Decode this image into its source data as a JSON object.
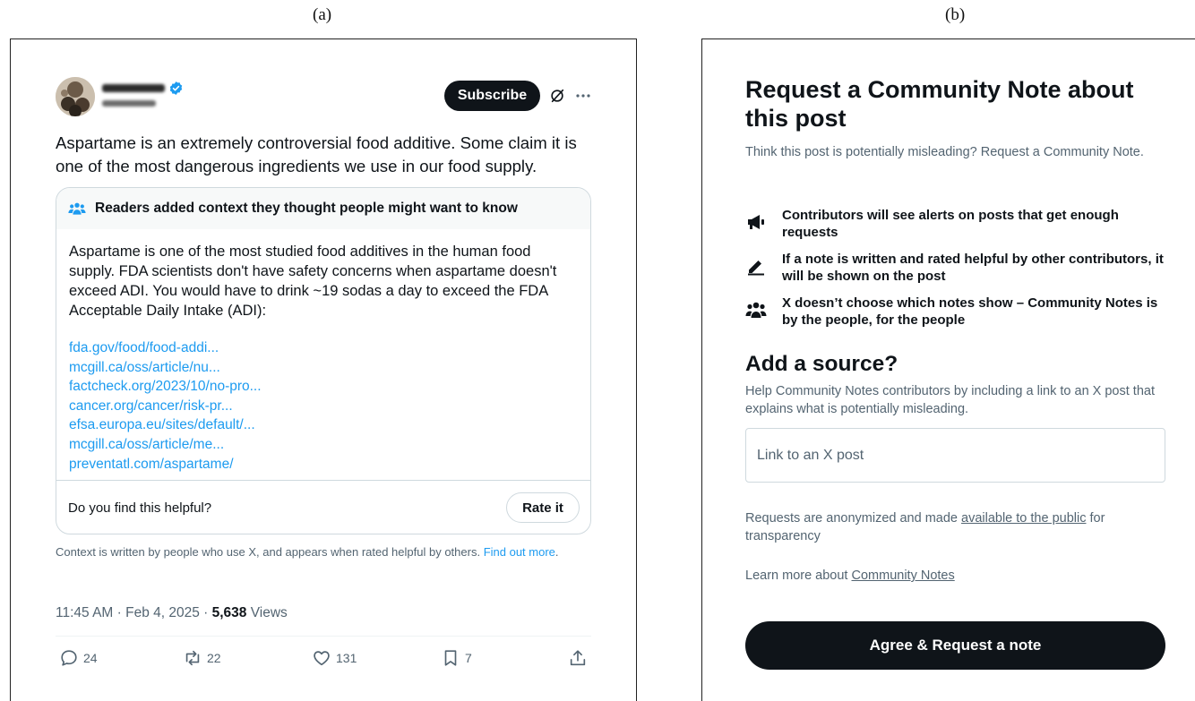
{
  "panel_labels": {
    "a": "(a)",
    "b": "(b)"
  },
  "tweet": {
    "subscribe_label": "Subscribe",
    "text": "Aspartame is an extremely controversial food additive. Some claim it is one of the most dangerous ingredients we use in our food supply.",
    "note": {
      "header": "Readers added context they thought people might want to know",
      "body": "Aspartame is one of the most studied food additives in the human food supply. FDA scientists don't have safety concerns when aspartame doesn't exceed ADI. You would have to drink ~19 sodas a day to exceed the FDA Acceptable Daily Intake (ADI):",
      "links": [
        "fda.gov/food/food-addi...",
        "mcgill.ca/oss/article/nu...",
        "factcheck.org/2023/10/no-pro...",
        "cancer.org/cancer/risk-pr...",
        "efsa.europa.eu/sites/default/...",
        "mcgill.ca/oss/article/me...",
        "preventatl.com/aspartame/"
      ],
      "helpful_question": "Do you find this helpful?",
      "rate_label": "Rate it"
    },
    "context_text": "Context is written by people who use X, and appears when rated helpful by others.",
    "context_link": "Find out more",
    "timestamp": "11:45 AM · Feb 4, 2025 · ",
    "views_count": "5,638",
    "views_label": " Views",
    "actions": {
      "replies": "24",
      "reposts": "22",
      "likes": "131",
      "bookmarks": "7"
    }
  },
  "request": {
    "title": "Request a Community Note about this post",
    "subtitle": "Think this post is potentially misleading? Request a Community Note.",
    "features": [
      "Contributors will see alerts on posts that get enough requests",
      "If a note is written and rated helpful by other contributors, it will be shown on the post",
      "X doesn’t choose which notes show – Community Notes is by the people, for the people"
    ],
    "source_title": "Add a source?",
    "source_subtitle": "Help Community Notes contributors by including a link to an X post that explains what is potentially misleading.",
    "input_placeholder": "Link to an X post",
    "anon_prefix": "Requests are anonymized and made ",
    "anon_link": "available to the public",
    "anon_suffix": " for transparency",
    "learn_prefix": "Learn more about ",
    "learn_link": "Community Notes",
    "agree_label": "Agree & Request a note"
  },
  "colors": {
    "link": "#1d9bf0",
    "dark": "#0f1419",
    "muted": "#536471",
    "border": "#cfd9de"
  }
}
